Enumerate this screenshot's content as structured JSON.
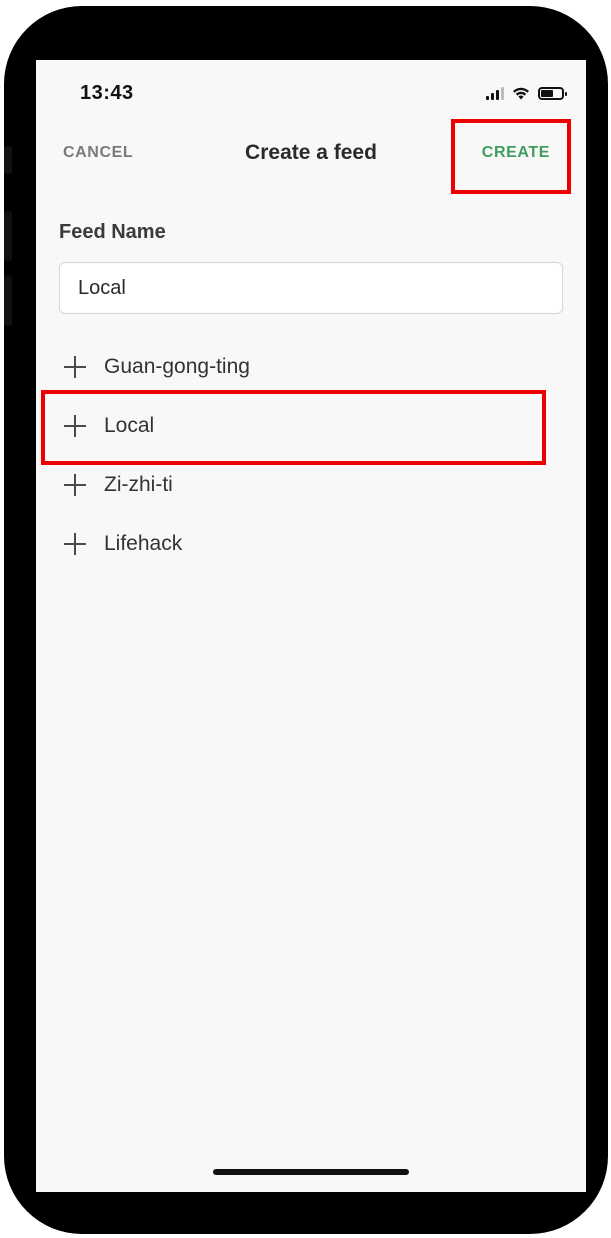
{
  "status_bar": {
    "time": "13:43",
    "icons": [
      "cellular-signal-icon",
      "wifi-icon",
      "battery-icon"
    ]
  },
  "nav": {
    "cancel_label": "CANCEL",
    "title": "Create a feed",
    "create_label": "CREATE"
  },
  "form": {
    "feed_name_label": "Feed Name",
    "feed_name_value": "Local"
  },
  "feeds": [
    {
      "label": "Guan-gong-ting",
      "icon": "plus-icon"
    },
    {
      "label": "Local",
      "icon": "plus-icon"
    },
    {
      "label": "Zi-zhi-ti",
      "icon": "plus-icon"
    },
    {
      "label": "Lifehack",
      "icon": "plus-icon"
    }
  ],
  "colors": {
    "accent_green": "#3f9e5f",
    "highlight_red": "#ee0000",
    "muted_gray": "#7a7a7a",
    "background": "#f8f8f8"
  }
}
